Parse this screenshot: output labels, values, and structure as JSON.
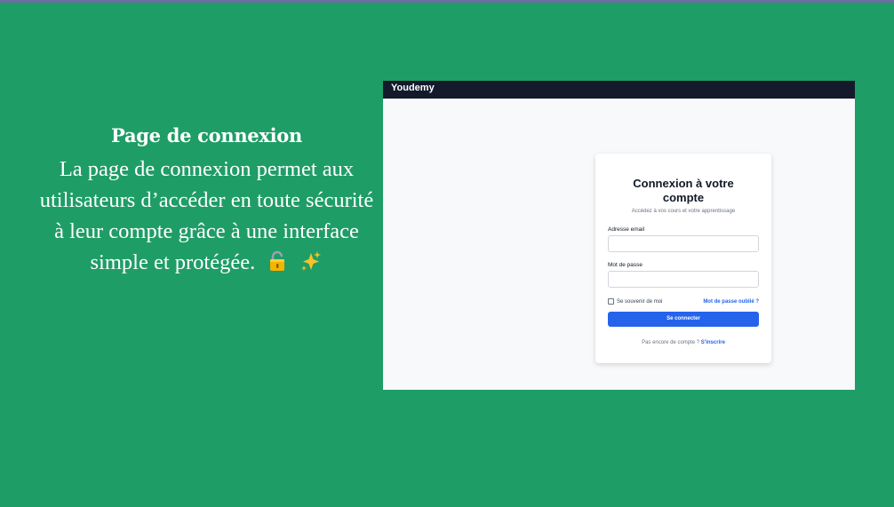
{
  "slide": {
    "title": "Page de connexion",
    "body": "La page de connexion permet aux utilisateurs d’accéder en toute sécurité à leur compte grâce à une interface simple et protégée.",
    "emoji_icons": [
      "lock-icon",
      "sparkles-icon"
    ]
  },
  "app": {
    "brand": "Youdemy"
  },
  "login": {
    "title": "Connexion à votre compte",
    "subtitle": "Accédez à vos cours et votre apprentissage",
    "email_label": "Adresse email",
    "email_value": "",
    "password_label": "Mot de passe",
    "password_value": "",
    "remember_label": "Se souvenir de moi",
    "remember_checked": false,
    "forgot_label": "Mot de passe oublié ?",
    "submit_label": "Se connecter",
    "signup_prompt": "Pas encore de compte ?",
    "signup_link": "S'inscrire"
  },
  "colors": {
    "background": "#1f9d66",
    "navbar": "#141a2c",
    "accent": "#2563eb"
  }
}
